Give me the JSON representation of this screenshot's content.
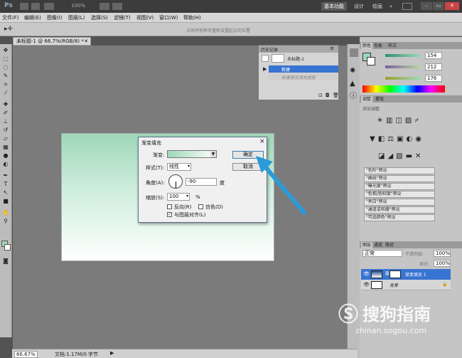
{
  "app": {
    "logo": "Ps",
    "zoom": "100%",
    "workspace_buttons": [
      "基本功能",
      "设计",
      "绘画"
    ]
  },
  "menu": [
    "文件(F)",
    "编辑(E)",
    "图像(I)",
    "图层(L)",
    "选择(S)",
    "滤镜(T)",
    "视图(V)",
    "窗口(W)",
    "帮助(H)"
  ],
  "options_bar": {
    "hint": "点按并拖移可重新设置起点的位置"
  },
  "document": {
    "tab_title": "未标题-1 @ 66.7%(RGB/8) *",
    "zoom": "66.67%",
    "doc_info": "文档:1.17M/0 字节"
  },
  "history": {
    "title": "历史记录",
    "snapshot": "未标题-1",
    "items": [
      "新建",
      "新建渐变填充图层"
    ]
  },
  "color_panel": {
    "tabs": [
      "颜色",
      "色板",
      "样式"
    ],
    "values": [
      "154",
      "212",
      "176"
    ],
    "colors": {
      "slider1": "#5fbf8f",
      "slider2": "#7fc77f",
      "slider3": "#8fd08f"
    }
  },
  "adjustments": {
    "tabs": [
      "调整",
      "蒙版"
    ],
    "header": "添加调整",
    "presets": [
      "\"色阶\"预设",
      "\"曲线\"预设",
      "\"曝光度\"预设",
      "\"色相/饱和度\"预设",
      "\"黑白\"预设",
      "\"通道混和器\"预设",
      "\"可选颜色\"预设"
    ]
  },
  "layers": {
    "tabs": [
      "图层",
      "通道",
      "路径"
    ],
    "blend_mode": "正常",
    "opacity_label": "不透明度:",
    "opacity": "100%",
    "fill_label": "填充:",
    "fill": "100%",
    "rows": [
      {
        "name": "渐变填充 1",
        "selected": true
      },
      {
        "name": "背景",
        "selected": false
      }
    ]
  },
  "dialog": {
    "title": "渐变填充",
    "gradient_label": "渐变:",
    "style_label": "样式(T):",
    "style_value": "线性",
    "angle_label": "角度(A):",
    "angle_value": "-90",
    "angle_unit": "度",
    "scale_label": "缩放(S):",
    "scale_value": "100",
    "scale_unit": "%",
    "reverse_label": "反向(R)",
    "dither_label": "仿色(D)",
    "align_label": "与图层对齐(L)",
    "ok": "确定",
    "cancel": "取消",
    "colors": {
      "gradient_start": "#9ed8b8",
      "gradient_end": "#ffffff",
      "arrow": "#2b9ad8"
    }
  },
  "watermark": {
    "name": "搜狗指南",
    "url": "zhinan.sogou.com"
  }
}
